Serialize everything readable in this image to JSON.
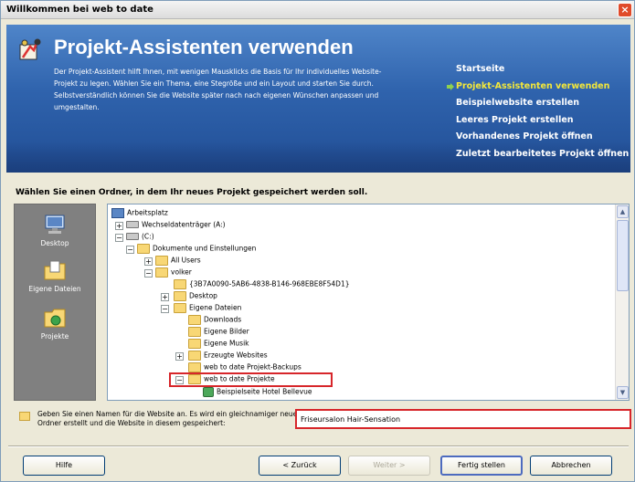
{
  "window": {
    "title": "Willkommen bei web to date"
  },
  "banner": {
    "title": "Projekt-Assistenten verwenden",
    "description": "Der Projekt-Assistent hilft Ihnen, mit wenigen Mausklicks die Basis für Ihr individuelles Website-Projekt zu legen. Wählen Sie ein Thema, eine Stegröße und ein Layout und starten Sie durch. Selbstverständlich können Sie die Website später nach nach eigenen Wünschen anpassen und umgestalten.",
    "nav": [
      {
        "label": "Startseite",
        "active": false
      },
      {
        "label": "Projekt-Assistenten verwenden",
        "active": true
      },
      {
        "label": "Beispielwebsite erstellen",
        "active": false
      },
      {
        "label": "Leeres Projekt erstellen",
        "active": false
      },
      {
        "label": "Vorhandenes Projekt öffnen",
        "active": false
      },
      {
        "label": "Zuletzt bearbeitetes Projekt öffnen",
        "active": false
      }
    ]
  },
  "folder_section": {
    "label": "Wählen Sie einen Ordner, in dem Ihr neues Projekt gespeichert werden soll."
  },
  "places": [
    {
      "label": "Desktop",
      "icon": "desktop-icon"
    },
    {
      "label": "Eigene Dateien",
      "icon": "my-documents-icon"
    },
    {
      "label": "Projekte",
      "icon": "projects-folder-icon"
    }
  ],
  "tree": [
    {
      "label": "Arbeitsplatz",
      "icon": "computer-icon",
      "expander": ""
    },
    {
      "label": "Wechseldatenträger (A:)",
      "icon": "drive-icon",
      "expander": "+"
    },
    {
      "label": "(C:)",
      "icon": "drive-icon",
      "expander": "−"
    },
    {
      "label": "Dokumente und Einstellungen",
      "icon": "folder-icon",
      "expander": "−"
    },
    {
      "label": "All Users",
      "icon": "folder-icon",
      "expander": "+"
    },
    {
      "label": "volker",
      "icon": "folder-icon",
      "expander": "−"
    },
    {
      "label": "{3B7A0090-5AB6-4838-B146-968EBE8F54D1}",
      "icon": "folder-icon",
      "expander": ""
    },
    {
      "label": "Desktop",
      "icon": "folder-icon",
      "expander": "+"
    },
    {
      "label": "Eigene Dateien",
      "icon": "folder-icon",
      "expander": "−"
    },
    {
      "label": "Downloads",
      "icon": "folder-icon",
      "expander": ""
    },
    {
      "label": "Eigene Bilder",
      "icon": "folder-icon",
      "expander": ""
    },
    {
      "label": "Eigene Musik",
      "icon": "folder-icon",
      "expander": ""
    },
    {
      "label": "Erzeugte Websites",
      "icon": "folder-icon",
      "expander": "+"
    },
    {
      "label": "web to date Projekt-Backups",
      "icon": "folder-icon",
      "expander": ""
    },
    {
      "label": "web to date Projekte",
      "icon": "folder-open-icon",
      "expander": "−",
      "selected": true
    },
    {
      "label": "Beispielseite Hotel Bellevue",
      "icon": "website-icon",
      "expander": ""
    }
  ],
  "name_field": {
    "hint": "Geben Sie einen Namen für die Website an. Es wird ein gleichnamiger neuer Ordner erstellt und die Website in diesem gespeichert:",
    "value": "Friseursalon Hair-Sensation"
  },
  "buttons": {
    "help": "Hilfe",
    "back": "< Zurück",
    "next": "Weiter >",
    "finish": "Fertig stellen",
    "cancel": "Abbrechen"
  },
  "colors": {
    "banner_top": "#4f85c9",
    "banner_bottom": "#214e95",
    "nav_active": "#f3e73a",
    "highlight": "#d7262a",
    "folder": "#f8d775"
  }
}
